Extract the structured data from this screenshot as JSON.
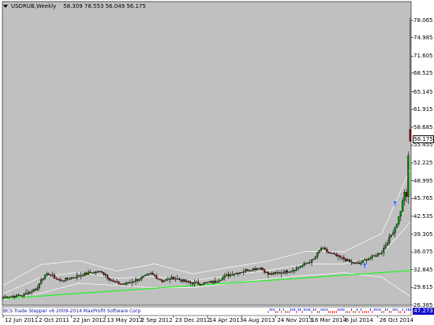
{
  "header": {
    "symbol_text": "USDRUB,Weekly",
    "ohlc_text": "58.309 78.553 56.049 56.175"
  },
  "indicator": {
    "label": "BCS Trade Stepper v6 2009-2014  MaxProfit Software Corp",
    "value": "47.273"
  },
  "current_price": "56.175",
  "colors": {
    "background": "#c0c0c0",
    "bull_candle": "#008000",
    "bear_candle": "#800000",
    "trendline": "#00ff00",
    "bands": "#ffffff",
    "indicator_bg": "#1010cc"
  },
  "chart_data": {
    "type": "candlestick",
    "title": "USDRUB,Weekly",
    "xlabel": "",
    "ylabel": "",
    "ylim": [
      26.385,
      81.5
    ],
    "x_tick_labels": [
      "12 Jun 2011",
      "2 Oct 2011",
      "22 Jan 2012",
      "13 May 2012",
      "2 Sep 2012",
      "23 Dec 2012",
      "14 Apr 2013",
      "4 Aug 2013",
      "24 Nov 2013",
      "16 Mar 2014",
      "6 Jul 2014",
      "26 Oct 2014"
    ],
    "y_tick_labels": [
      "78.065",
      "74.985",
      "71.605",
      "68.525",
      "65.145",
      "61.915",
      "58.685",
      "55.455",
      "52.225",
      "48.995",
      "45.765",
      "42.535",
      "39.305",
      "36.075",
      "32.845",
      "29.615",
      "26.385"
    ],
    "close_anchors": [
      [
        0,
        27.9
      ],
      [
        10,
        28.2
      ],
      [
        18,
        29.5
      ],
      [
        20,
        31.2
      ],
      [
        24,
        32.1
      ],
      [
        30,
        30.8
      ],
      [
        38,
        31.6
      ],
      [
        46,
        32.3
      ],
      [
        52,
        32.5
      ],
      [
        58,
        30.6
      ],
      [
        64,
        30.2
      ],
      [
        72,
        31.2
      ],
      [
        78,
        32.1
      ],
      [
        84,
        30.8
      ],
      [
        90,
        31.4
      ],
      [
        98,
        30.5
      ],
      [
        104,
        30.3
      ],
      [
        112,
        30.7
      ],
      [
        118,
        31.8
      ],
      [
        124,
        32.3
      ],
      [
        130,
        32.9
      ],
      [
        136,
        33.2
      ],
      [
        140,
        32.0
      ],
      [
        146,
        32.3
      ],
      [
        152,
        32.7
      ],
      [
        158,
        33.6
      ],
      [
        164,
        34.7
      ],
      [
        168,
        36.8
      ],
      [
        172,
        35.9
      ],
      [
        176,
        35.3
      ],
      [
        180,
        34.8
      ],
      [
        184,
        34.1
      ],
      [
        188,
        33.9
      ],
      [
        192,
        34.8
      ],
      [
        196,
        35.3
      ],
      [
        200,
        36.1
      ],
      [
        204,
        38.6
      ],
      [
        206,
        39.8
      ],
      [
        208,
        41.3
      ],
      [
        210,
        43.6
      ],
      [
        212,
        47.0
      ],
      [
        213,
        45.9
      ],
      [
        214,
        53.5
      ],
      [
        215,
        56.175
      ]
    ],
    "last_candle": {
      "open": 58.309,
      "high": 78.553,
      "low": 56.049,
      "close": 56.175
    },
    "trendline": [
      [
        0,
        27.6
      ],
      [
        215,
        32.7
      ]
    ],
    "bands": {
      "upper": [
        [
          0,
          30.0
        ],
        [
          20,
          33.8
        ],
        [
          40,
          34.5
        ],
        [
          60,
          32.6
        ],
        [
          80,
          33.9
        ],
        [
          100,
          32.1
        ],
        [
          120,
          33.3
        ],
        [
          140,
          34.4
        ],
        [
          160,
          36.2
        ],
        [
          180,
          36.1
        ],
        [
          200,
          39.4
        ],
        [
          215,
          51.0
        ]
      ],
      "middle": [
        [
          0,
          28.5
        ],
        [
          20,
          31.5
        ],
        [
          40,
          32.4
        ],
        [
          60,
          31.3
        ],
        [
          80,
          31.6
        ],
        [
          100,
          30.9
        ],
        [
          120,
          31.8
        ],
        [
          140,
          32.7
        ],
        [
          160,
          33.9
        ],
        [
          180,
          33.9
        ],
        [
          200,
          35.6
        ],
        [
          215,
          41.5
        ]
      ],
      "lower": [
        [
          0,
          27.4
        ],
        [
          20,
          28.6
        ],
        [
          40,
          30.4
        ],
        [
          60,
          30.0
        ],
        [
          80,
          29.6
        ],
        [
          100,
          29.6
        ],
        [
          120,
          30.4
        ],
        [
          140,
          31.2
        ],
        [
          160,
          31.8
        ],
        [
          180,
          32.3
        ],
        [
          200,
          31.5
        ],
        [
          215,
          28.0
        ]
      ]
    },
    "markers": [
      {
        "type": "arrow-up",
        "bar": 191,
        "price": 34.2
      },
      {
        "type": "arrow-up",
        "bar": 207,
        "price": 45.5
      }
    ],
    "grid": false,
    "legend": "none"
  }
}
